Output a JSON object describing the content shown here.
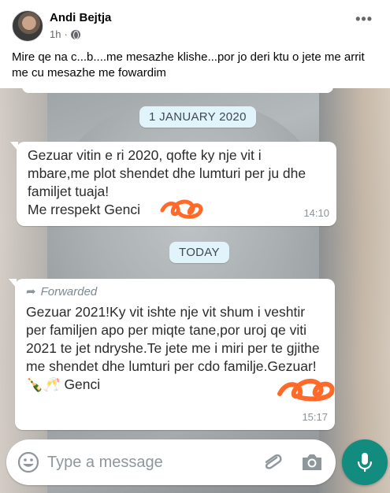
{
  "post": {
    "author": "Andi Bejtja",
    "time": "1h",
    "privacy_icon": "globe-icon",
    "more_icon": "more-options-icon",
    "more_label": "•••",
    "text": "Mire qe na c...b....me mesazhe klishe...por jo deri ktu o jete me arrit me cu mesazhe me fowardim"
  },
  "chat": {
    "date_chips": [
      "1 JANUARY 2020",
      "TODAY"
    ],
    "messages": [
      {
        "text": "Gezuar vitin e ri 2020, qofte ky nje vit i mbare,me plot shendet dhe lumturi per ju dhe familjet tuaja!\nMe rrespekt Genci",
        "time": "14:10"
      },
      {
        "forwarded_label": "Forwarded",
        "text": "Gezuar 2021!Ky vit ishte nje vit shum i veshtir per familjen apo per miqte tane,por uroj qe viti 2021 te jet ndryshe.Te jete me i miri per te gjithe me shendet dhe lumturi per cdo familje.Gezuar!🍾🥂 Genci",
        "time": "15:17"
      }
    ],
    "input": {
      "placeholder": "Type a message"
    },
    "icons": [
      "emoji-icon",
      "attach-icon",
      "camera-icon",
      "mic-icon"
    ]
  },
  "colors": {
    "accent_green": "#128c7e",
    "chip_bg": "#e1f3fb",
    "scribble": "#ff6a2a"
  }
}
